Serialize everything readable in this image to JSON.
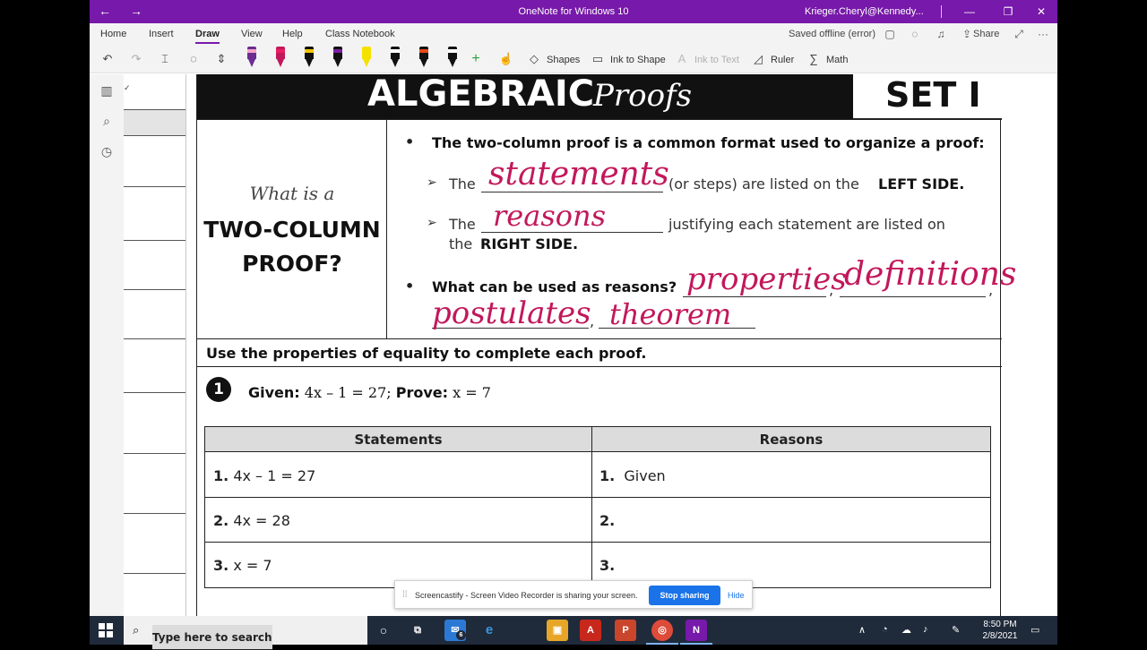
{
  "window": {
    "title": "OneNote for Windows 10",
    "user": "Krieger.Cheryl@Kennedy...",
    "controls": {
      "minimize": "—",
      "restore": "❐",
      "close": "✕"
    },
    "nav": {
      "back": "←",
      "forward": "→"
    }
  },
  "ribbon": {
    "tabs": [
      "Home",
      "Insert",
      "Draw",
      "View",
      "Help",
      "Class Notebook"
    ],
    "active_tab": "Draw",
    "status": "Saved offline (error)",
    "share_label": "Share",
    "more": "···"
  },
  "toolbar": {
    "shapes_label": "Shapes",
    "ink_to_shape_label": "Ink to Shape",
    "ink_to_text_label": "Ink to Text",
    "ruler_label": "Ruler",
    "math_label": "Math",
    "pens": [
      {
        "color": "#6b2c91",
        "band": "#f5a3c7"
      },
      {
        "color": "#c2185b",
        "band": "#e91e63",
        "selected": true
      },
      {
        "color": "#111111",
        "band": "#f5c400"
      },
      {
        "color": "#111111",
        "band": "#7b1fa2"
      },
      {
        "color": "#f5e100",
        "band": "#f5e100"
      },
      {
        "color": "#111111",
        "band": "#ffffff"
      },
      {
        "color": "#111111",
        "band": "#e64a19"
      },
      {
        "color": "#111111",
        "band": "#ffffff"
      }
    ]
  },
  "worksheet": {
    "header_title": "ALGEBRAIC",
    "header_script": "Proofs",
    "set_label": "SET I",
    "what_is_a": "What is a",
    "two_column_line1": "TWO-COLUMN",
    "two_column_line2": "PROOF?",
    "bullet1": "The two-column proof is a common format used to organize a proof:",
    "line1_pre": "The",
    "line1_post": "(or steps) are listed on the",
    "line1_bold": "LEFT SIDE.",
    "line2_pre": "The",
    "line2_post": "justifying each statement are listed on",
    "line2b_pre": "the",
    "line2b_bold": "RIGHT SIDE.",
    "bullet2": "What can be used as reasons?",
    "comma": ",",
    "instruction": "Use the properties of equality to complete each proof.",
    "problem_number": "1",
    "given_label": "Given:",
    "given_value": "4x – 1 = 27;",
    "prove_label": "Prove:",
    "prove_value": "x = 7",
    "table": {
      "headers": [
        "Statements",
        "Reasons"
      ],
      "rows": [
        {
          "num": "1.",
          "statement": "4x – 1 = 27",
          "reason_num": "1.",
          "reason": "Given"
        },
        {
          "num": "2.",
          "statement": "4x = 28",
          "reason_num": "2.",
          "reason": ""
        },
        {
          "num": "3.",
          "statement": "x = 7",
          "reason_num": "3.",
          "reason": ""
        }
      ]
    }
  },
  "ink": {
    "statements": "statements",
    "reasons": "reasons",
    "properties": "properties",
    "definitions": "definitions",
    "postulates": "postulates",
    "theorem": "theorem",
    "color": "#c2185b"
  },
  "banner": {
    "message": "Screencastify - Screen Video Recorder is sharing your screen.",
    "stop": "Stop sharing",
    "hide": "Hide"
  },
  "taskbar": {
    "search_placeholder": "Type here to search",
    "time": "8:50 PM",
    "date": "2/8/2021",
    "mail_badge": "6"
  }
}
